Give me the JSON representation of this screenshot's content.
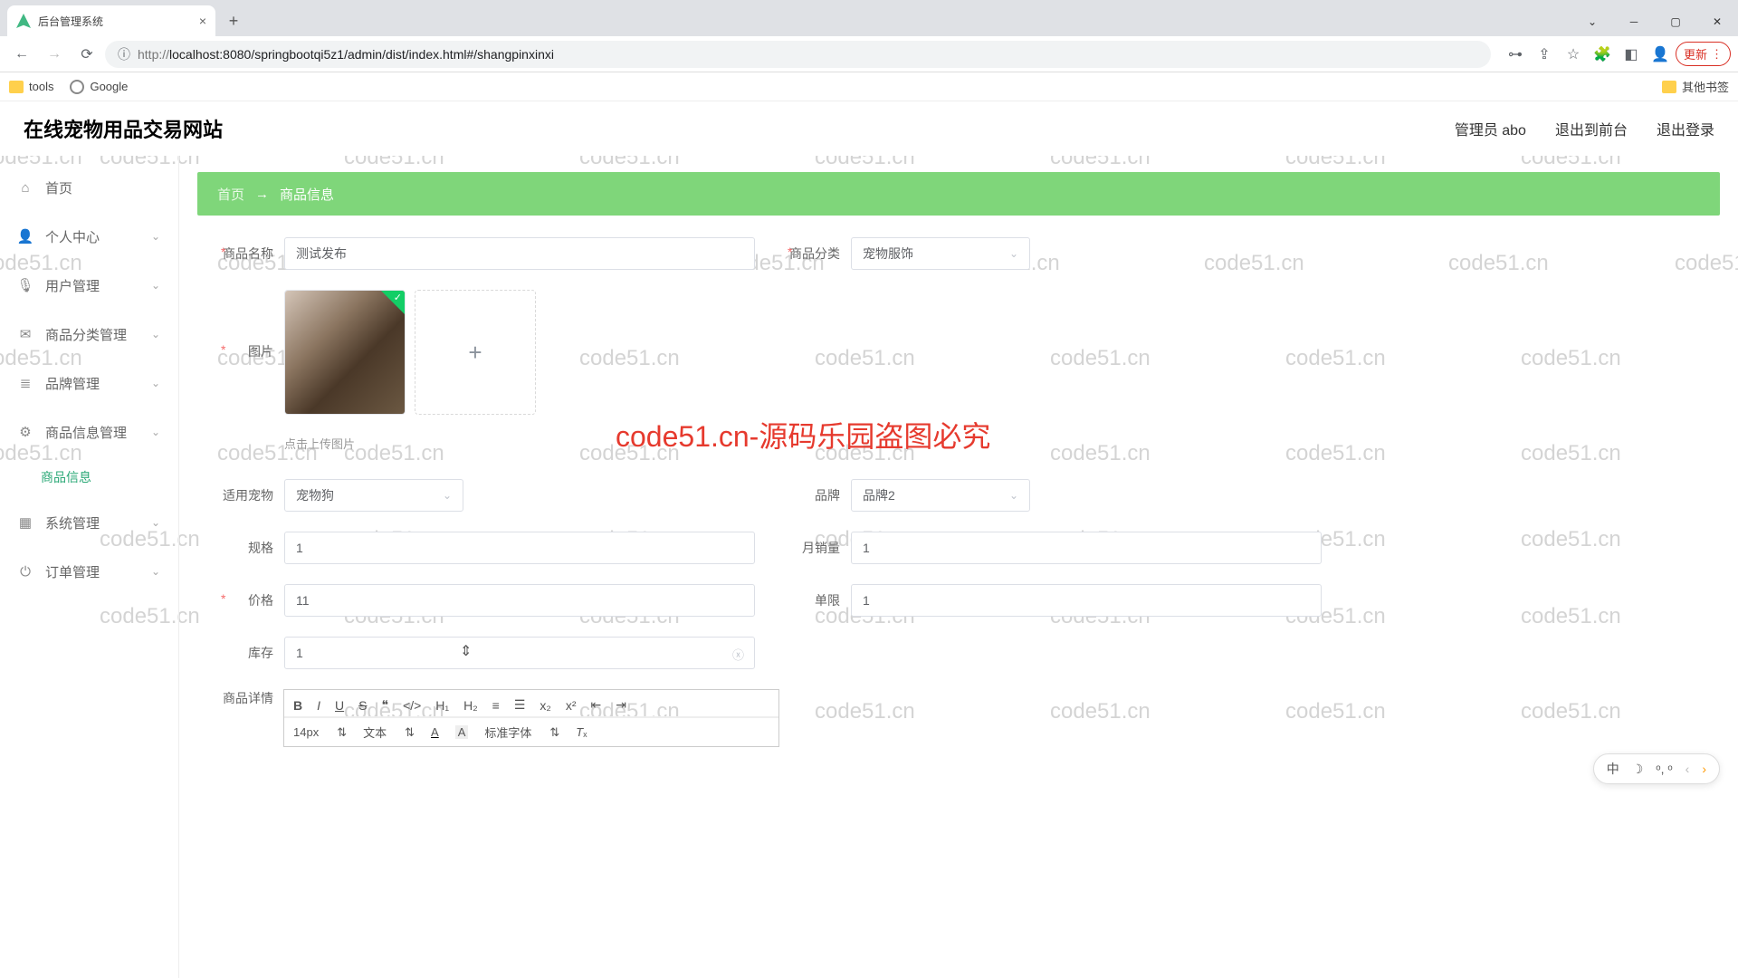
{
  "browser": {
    "tab_title": "后台管理系统",
    "url_prefix": "http://",
    "url_host": "localhost",
    "url_path": ":8080/springbootqi5z1/admin/dist/index.html#/shangpinxinxi",
    "update_label": "更新",
    "bookmarks": {
      "tools": "tools",
      "google": "Google",
      "other": "其他书签"
    }
  },
  "header": {
    "title": "在线宠物用品交易网站",
    "admin": "管理员 abo",
    "exit_front": "退出到前台",
    "exit_login": "退出登录"
  },
  "sidebar": {
    "home": "首页",
    "personal": "个人中心",
    "user_mgmt": "用户管理",
    "cat_mgmt": "商品分类管理",
    "brand_mgmt": "品牌管理",
    "product_mgmt": "商品信息管理",
    "product_info": "商品信息",
    "system_mgmt": "系统管理",
    "order_mgmt": "订单管理"
  },
  "breadcrumb": {
    "home": "首页",
    "arrow": "→",
    "current": "商品信息"
  },
  "form": {
    "name_label": "商品名称",
    "name_value": "测试发布",
    "category_label": "商品分类",
    "category_value": "宠物服饰",
    "image_label": "图片",
    "image_hint": "点击上传图片",
    "pet_label": "适用宠物",
    "pet_value": "宠物狗",
    "brand_label": "品牌",
    "brand_value": "品牌2",
    "spec_label": "规格",
    "spec_value": "1",
    "sales_label": "月销量",
    "sales_value": "1",
    "price_label": "价格",
    "price_value": "11",
    "limit_label": "单限",
    "limit_value": "1",
    "stock_label": "库存",
    "stock_value": "1",
    "detail_label": "商品详情",
    "font_size": "14px",
    "font_type": "文本",
    "font_family": "标准字体"
  },
  "watermark": "code51.cn",
  "watermark_red": "code51.cn-源码乐园盗图必究",
  "ime": {
    "lang": "中",
    "moon": "☽",
    "punct": "ᵒ, ᵒ"
  }
}
